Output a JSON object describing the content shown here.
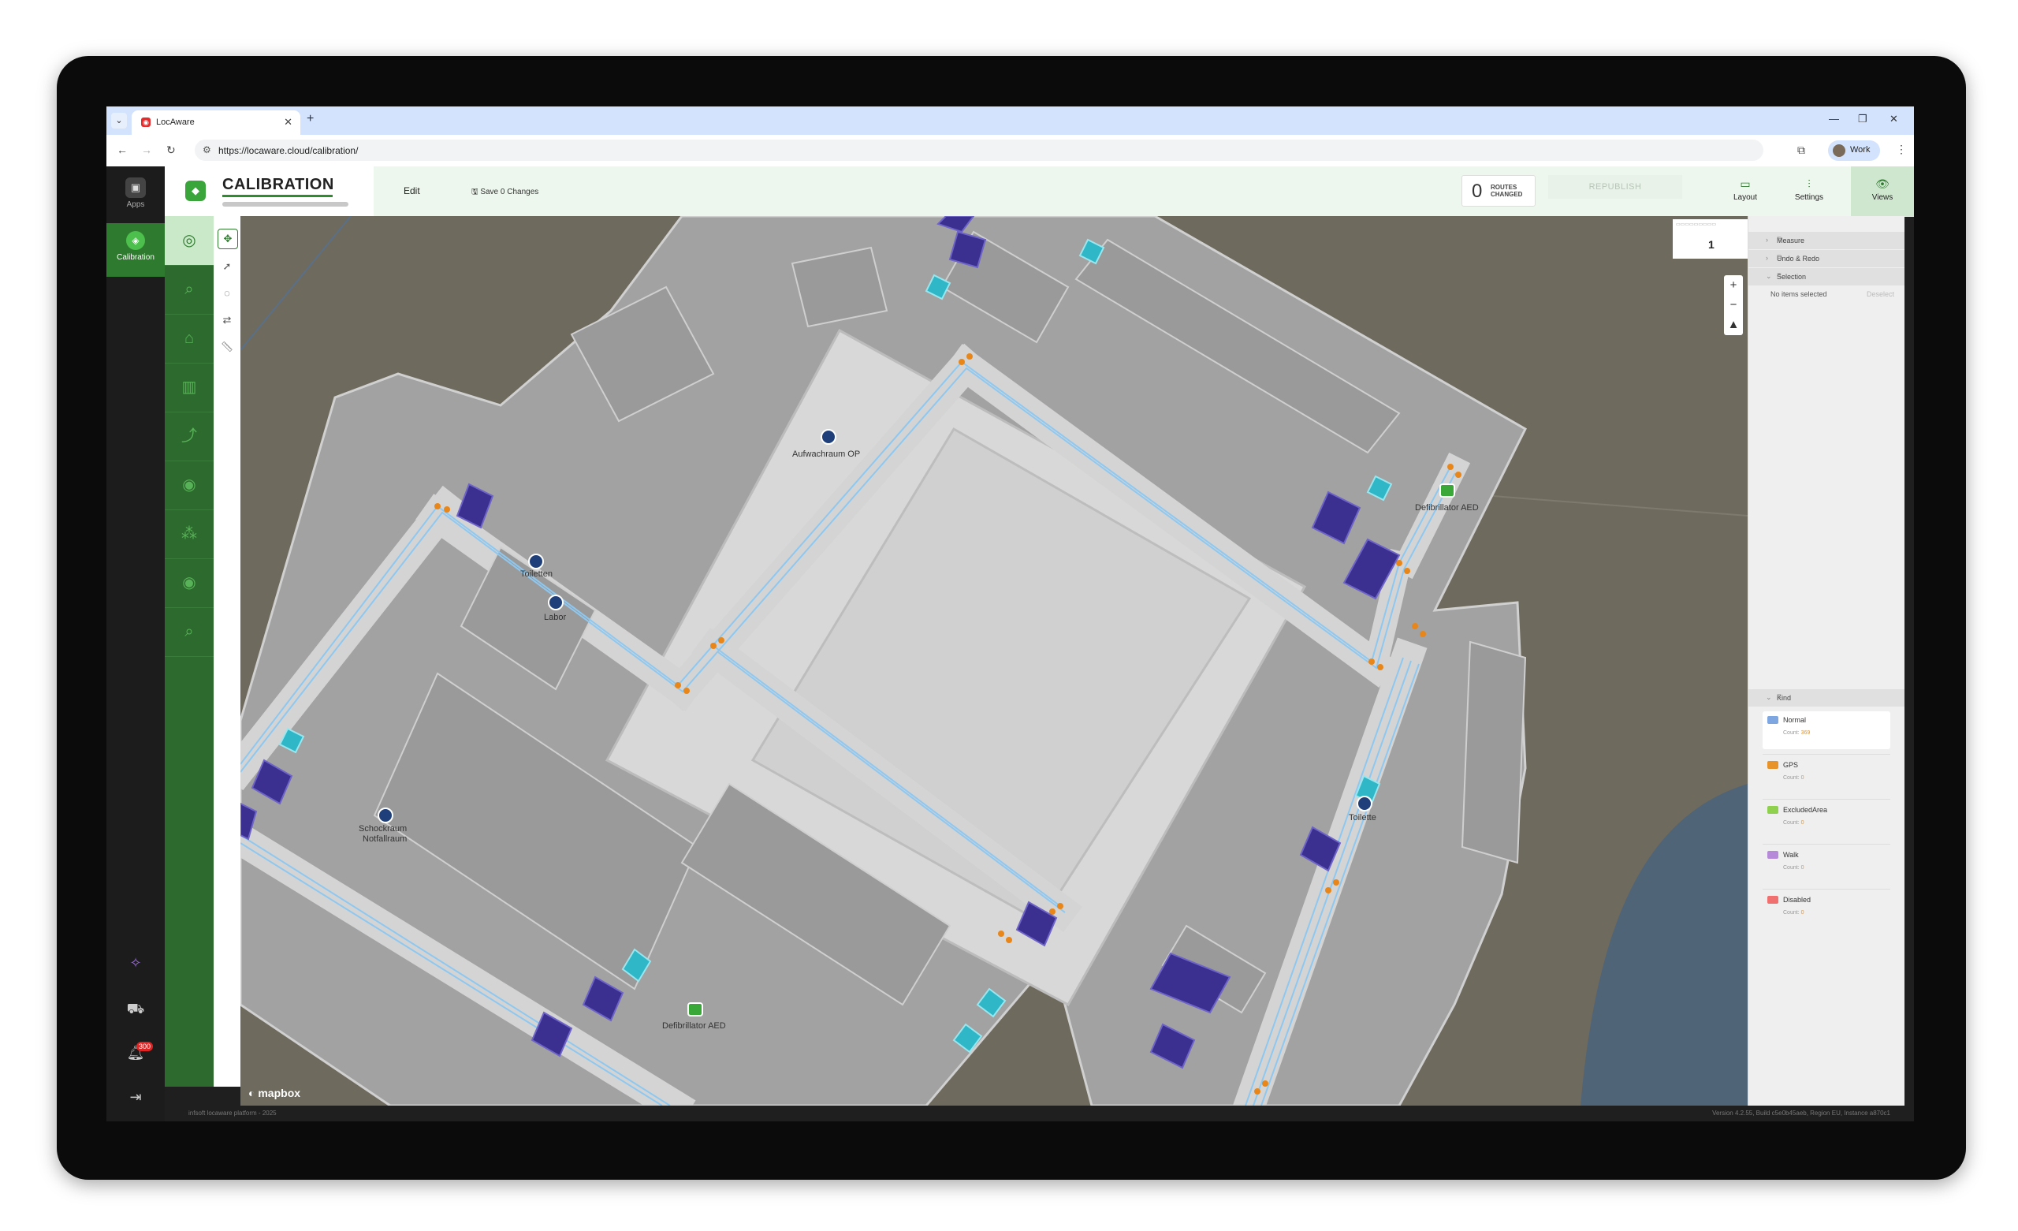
{
  "browser": {
    "tab_title": "LocAware",
    "url": "https://locaware.cloud/calibration/",
    "profile_label": "Work"
  },
  "rail": {
    "apps_label": "Apps",
    "calibration_label": "Calibration",
    "notification_count": "300"
  },
  "header": {
    "title": "CALIBRATION",
    "edit_label": "Edit",
    "save_label": "Save 0 Changes",
    "routes_count": "0",
    "routes_label_line1": "ROUTES",
    "routes_label_line2": "CHANGED",
    "republish_label": "REPUBLISH",
    "layout_label": "Layout",
    "settings_label": "Settings",
    "views_label": "Views"
  },
  "map": {
    "attribution": "mapbox",
    "floor_value": "1",
    "labels": [
      "Aufwachraum OP",
      "Toiletten",
      "Labor",
      "Schockraum Notfallraum",
      "Defibrillator AED",
      "Defibrillator AED",
      "Toilette"
    ]
  },
  "panel": {
    "measure_label": "Measure",
    "undo_label": "Undo & Redo",
    "selection_label": "Selection",
    "no_items_label": "No items selected",
    "clear_label": "Deselect",
    "kind_label": "Kind",
    "kinds": [
      {
        "label": "Normal",
        "count_prefix": "Count:",
        "count": "369",
        "color": "#7ea6e0"
      },
      {
        "label": "GPS",
        "count_prefix": "Count:",
        "count": "0",
        "color": "#e8932a"
      },
      {
        "label": "ExcludedArea",
        "count_prefix": "Count:",
        "count": "0",
        "color": "#8fd14f"
      },
      {
        "label": "Walk",
        "count_prefix": "Count:",
        "count": "0",
        "color": "#b68ad8"
      },
      {
        "label": "Disabled",
        "count_prefix": "Count:",
        "count": "0",
        "color": "#f07070"
      }
    ]
  },
  "footer": {
    "left": "infsoft locaware platform - 2025",
    "right": "Version 4.2.55, Build c5e0b45aeb, Region EU, Instance a870c1"
  },
  "colors": {
    "accent": "#2e7a2e",
    "rail_bg": "#1c1c1c",
    "map_bg": "#6e6a5e",
    "room_fill": "#9e9e9e",
    "corridor": "#d4d4d4",
    "route_line": "#8ec8f0",
    "route_node": "#e8861a",
    "poi_purple": "#3b2f8f",
    "poi_teal": "#2fb7c7"
  }
}
